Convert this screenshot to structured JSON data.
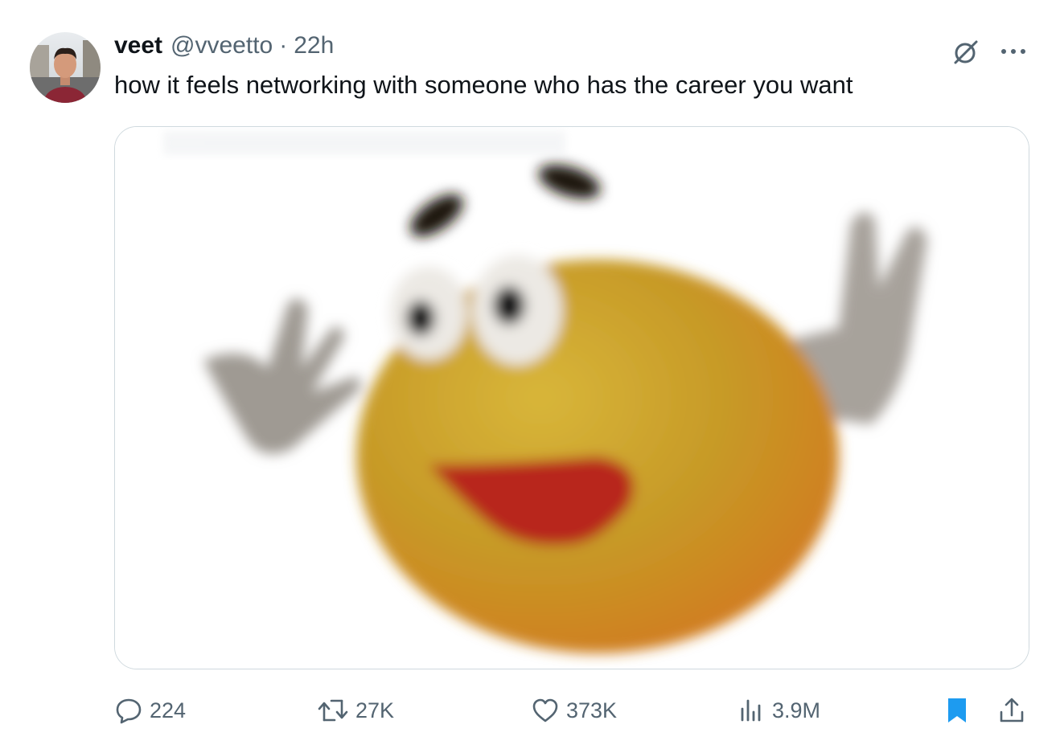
{
  "tweet": {
    "author_name": "veet",
    "handle": "@vveetto",
    "separator": "·",
    "time": "22h",
    "text": "how it feels networking with someone who has the career you want"
  },
  "icons": {
    "grok": "grok-icon",
    "more": "more-icon",
    "reply": "reply-icon",
    "retweet": "retweet-icon",
    "like": "like-icon",
    "views": "views-icon",
    "bookmark": "bookmark-icon",
    "share": "share-icon"
  },
  "stats": {
    "replies": "224",
    "retweets": "27K",
    "likes": "373K",
    "views": "3.9M"
  },
  "colors": {
    "text": "#0f1419",
    "secondary": "#536471",
    "accent": "#1d9bf0",
    "border": "#cfd9de"
  }
}
